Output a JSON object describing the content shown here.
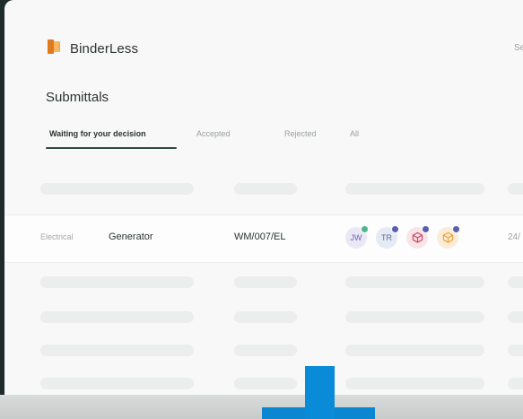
{
  "app": {
    "name": "BinderLess",
    "search_hint": "Se"
  },
  "page": {
    "title": "Submittals"
  },
  "tabs": [
    {
      "label": "Waiting for your decision",
      "active": true
    },
    {
      "label": "Accepted",
      "active": false
    },
    {
      "label": "Rejected",
      "active": false
    },
    {
      "label": "All",
      "active": false
    }
  ],
  "row": {
    "discipline": "Electrical",
    "title": "Generator",
    "code": "WM/007/EL",
    "reviewers": [
      {
        "initials": "JW",
        "status_color": "#4cb98a"
      },
      {
        "initials": "TR",
        "status_color": "#5b5fb0"
      },
      {
        "icon": "cube-icon",
        "icon_color": "#d6455f",
        "status_color": "#5b5fb0"
      },
      {
        "icon": "cube-icon",
        "icon_color": "#f0a33a",
        "status_color": "#5b5fb0"
      }
    ],
    "date": "24/"
  },
  "colors": {
    "accent": "#2d4a43",
    "logo": "#f0a33a",
    "highlight": "#0b86d1"
  }
}
